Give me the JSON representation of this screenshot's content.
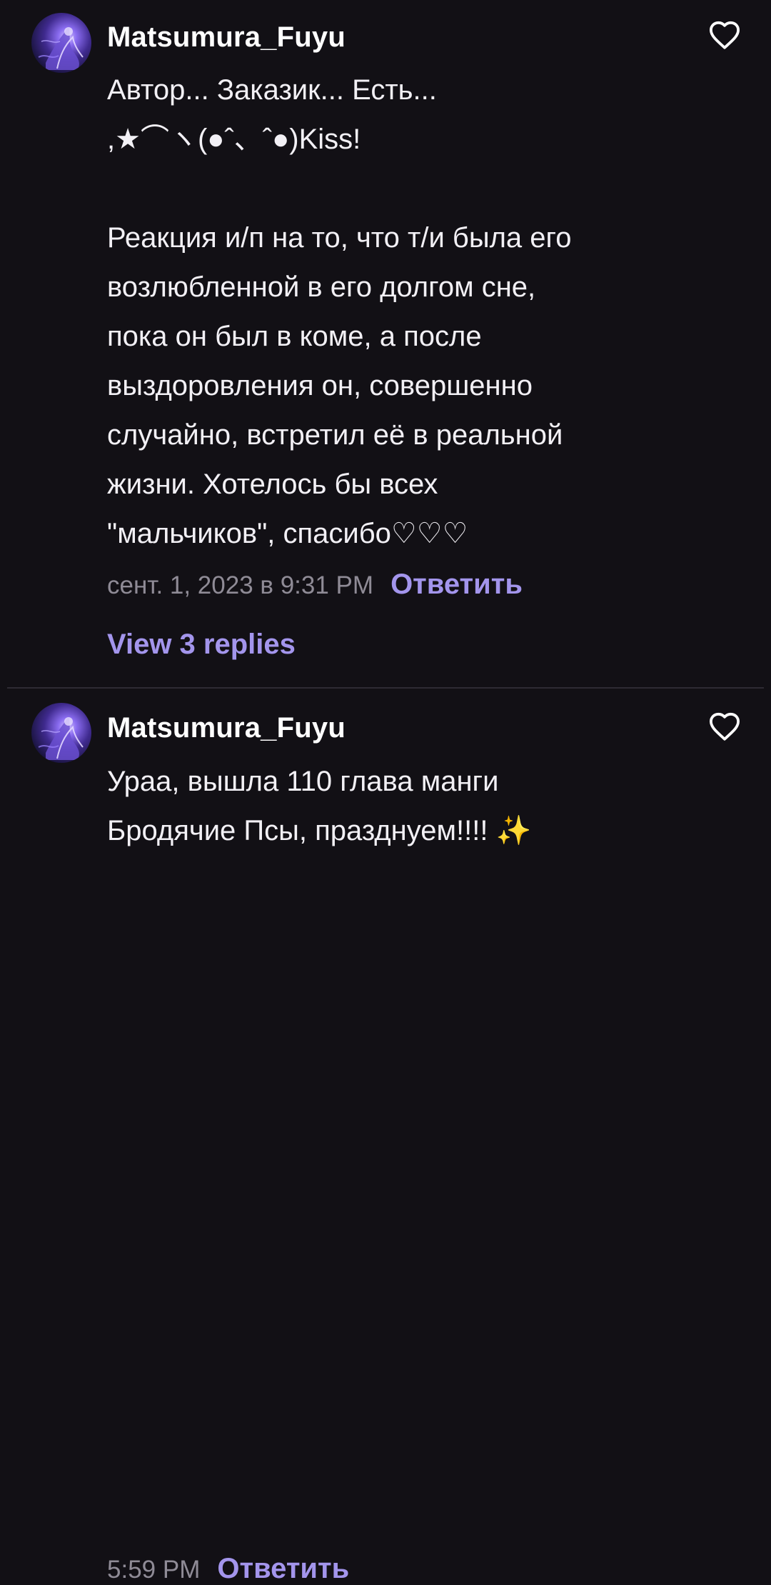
{
  "comments": [
    {
      "username": "Matsumura_Fuyu",
      "avatar_icon": "avatar-image",
      "like_icon": "heart-outline-icon",
      "body": "Автор... Заказик... Есть...\n,★⌒ヽ(●ˆ、ˆ●)Kiss!\n\nРеакция и/п на то, что т/и была его\nвозлюбленной в его долгом сне,\nпока он был в коме, а после\nвыздоровления он, совершенно\nслучайно, встретил её в реальной\nжизни. Хотелось бы всех\n\"мальчиков\", спасибо♡♡♡",
      "timestamp": "сент. 1, 2023 в 9:31 PM",
      "reply_label": "Ответить",
      "view_replies_label": "View 3 replies"
    },
    {
      "username": "Matsumura_Fuyu",
      "avatar_icon": "avatar-image",
      "like_icon": "heart-outline-icon",
      "body": "Ураа, вышла 110 глава манги\nБродячие Псы, празднуем!!!! ✨",
      "timestamp": "5:59 PM",
      "reply_label": "Ответить"
    }
  ],
  "colors": {
    "background": "#121015",
    "text": "#f2f0f5",
    "muted": "#8f8b96",
    "accent": "#a395ec",
    "divider": "#2e2b33"
  }
}
